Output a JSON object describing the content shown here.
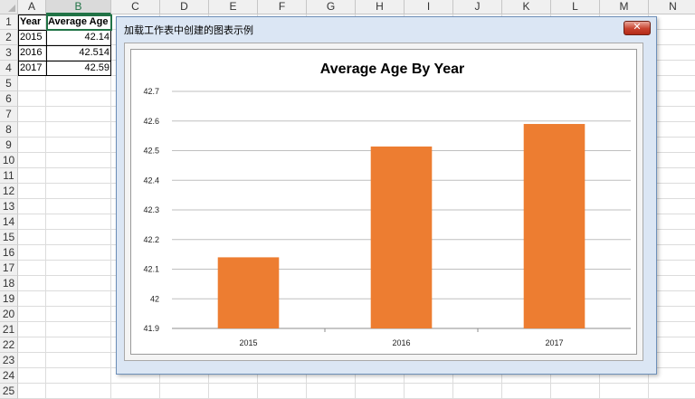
{
  "spreadsheet": {
    "columns": [
      "A",
      "B",
      "C",
      "D",
      "E",
      "F",
      "G",
      "H",
      "I",
      "J",
      "K",
      "L",
      "M",
      "N"
    ],
    "rows": [
      "1",
      "2",
      "3",
      "4",
      "5",
      "6",
      "7",
      "8",
      "9",
      "10",
      "11",
      "12",
      "13",
      "14",
      "15",
      "16",
      "17",
      "18",
      "19",
      "20",
      "21",
      "22",
      "23",
      "24",
      "25"
    ],
    "headers": {
      "a1": "Year",
      "b1": "Average Age"
    },
    "data_rows": [
      {
        "year": "2015",
        "avg": "42.14"
      },
      {
        "year": "2016",
        "avg": "42.514"
      },
      {
        "year": "2017",
        "avg": "42.59"
      }
    ],
    "colors": {
      "selection": "#217346",
      "grid": "#dcdcdc"
    }
  },
  "window": {
    "title": "加载工作表中创建的图表示例",
    "close_label": "✕",
    "colors": {
      "frame": "#dbe6f4",
      "close": "#c8422e"
    }
  },
  "chart_data": {
    "type": "bar",
    "title": "Average Age By Year",
    "categories": [
      "2015",
      "2016",
      "2017"
    ],
    "values": [
      42.14,
      42.514,
      42.59
    ],
    "ylim": [
      41.9,
      42.7
    ],
    "yticks": [
      41.9,
      42,
      42.1,
      42.2,
      42.3,
      42.4,
      42.5,
      42.6,
      42.7
    ],
    "ytick_labels": [
      "41.9",
      "42",
      "42.1",
      "42.2",
      "42.3",
      "42.4",
      "42.5",
      "42.6",
      "42.7"
    ],
    "xlabel": "",
    "ylabel": "",
    "grid": true,
    "bar_color": "#ed7d31"
  }
}
